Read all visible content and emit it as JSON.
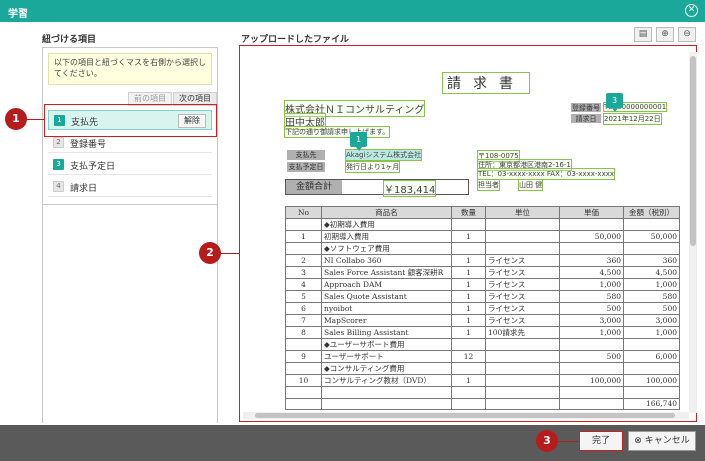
{
  "dialog": {
    "title": "学習",
    "close_icon": "close-circle-icon"
  },
  "left": {
    "heading": "紐づける項目",
    "notice": "以下の項目と紐づくマスを右側から選択してください。",
    "prev_label": "前の項目",
    "next_label": "次の項目",
    "unlink_label": "解除",
    "items": [
      {
        "num": "1",
        "label": "支払先",
        "state": "selected"
      },
      {
        "num": "2",
        "label": "登録番号",
        "state": "unlinked"
      },
      {
        "num": "3",
        "label": "支払予定日",
        "state": "linked"
      },
      {
        "num": "4",
        "label": "請求日",
        "state": "unlinked"
      }
    ]
  },
  "right": {
    "heading": "アップロードしたファイル",
    "tools": [
      "fit-page-icon",
      "zoom-in-icon",
      "zoom-out-icon"
    ]
  },
  "invoice": {
    "title": "請求書",
    "company": "株式会社ＮＩコンサルティング",
    "person": "田中太郎",
    "intro": "下記の通り御請求申し上げます。",
    "reg_no_tag": "登録番号",
    "reg_no_value": "T0000000000001",
    "invoice_date_tag": "請求日",
    "invoice_date_value": "2021年12月22日",
    "payee_tag": "支払先",
    "payee_value": "Akagiシステム株式会社",
    "due_tag": "支払予定日",
    "due_value": "発行日より1ヶ月",
    "postal": "〒108-0075",
    "address": "住所：東京都港区港南2-16-1",
    "contact": "TEL：03-xxxx-xxxx FAX：03-xxxx-xxxx",
    "staff_label": "担当者",
    "staff_name": "山田 健",
    "total_label": "金額合計",
    "total_value": "￥183,414",
    "marker_payee": "1",
    "marker_reg": "3"
  },
  "table": {
    "headers": [
      "No",
      "商品名",
      "数量",
      "単位",
      "単価",
      "金額（税別）"
    ],
    "rows": [
      [
        "",
        "◆初期導入費用",
        "",
        "",
        "",
        ""
      ],
      [
        "1",
        "初期導入費用",
        "1",
        "",
        "50,000",
        "50,000"
      ],
      [
        "",
        "◆ソフトウェア費用",
        "",
        "",
        "",
        ""
      ],
      [
        "2",
        "NI Collabo 360",
        "1",
        "ライセンス",
        "360",
        "360"
      ],
      [
        "3",
        "Sales Force Assistant 顧客深耕R",
        "1",
        "ライセンス",
        "4,500",
        "4,500"
      ],
      [
        "4",
        "Approach DAM",
        "1",
        "ライセンス",
        "1,000",
        "1,000"
      ],
      [
        "5",
        "Sales Quote Assistant",
        "1",
        "ライセンス",
        "580",
        "580"
      ],
      [
        "6",
        "nyoibot",
        "1",
        "ライセンス",
        "500",
        "500"
      ],
      [
        "7",
        "MapScorer",
        "1",
        "ライセンス",
        "3,000",
        "3,000"
      ],
      [
        "8",
        "Sales Billing Assistant",
        "1",
        "100請求先",
        "1,000",
        "1,000"
      ],
      [
        "",
        "◆ユーザーサポート費用",
        "",
        "",
        "",
        ""
      ],
      [
        "9",
        "ユーザーサポート",
        "12",
        "",
        "500",
        "6,000"
      ],
      [
        "",
        "◆コンサルティング費用",
        "",
        "",
        "",
        ""
      ],
      [
        "10",
        "コンサルティング教材（DVD）",
        "1",
        "",
        "100,000",
        "100,000"
      ],
      [
        "",
        "",
        "",
        "",
        "",
        ""
      ],
      [
        "",
        "",
        "",
        "",
        "",
        "166,740"
      ]
    ]
  },
  "callouts": [
    "1",
    "2",
    "3"
  ],
  "footer": {
    "done_label": "完了",
    "cancel_label": "キャンセル",
    "cancel_icon": "cancel-circle-icon"
  }
}
